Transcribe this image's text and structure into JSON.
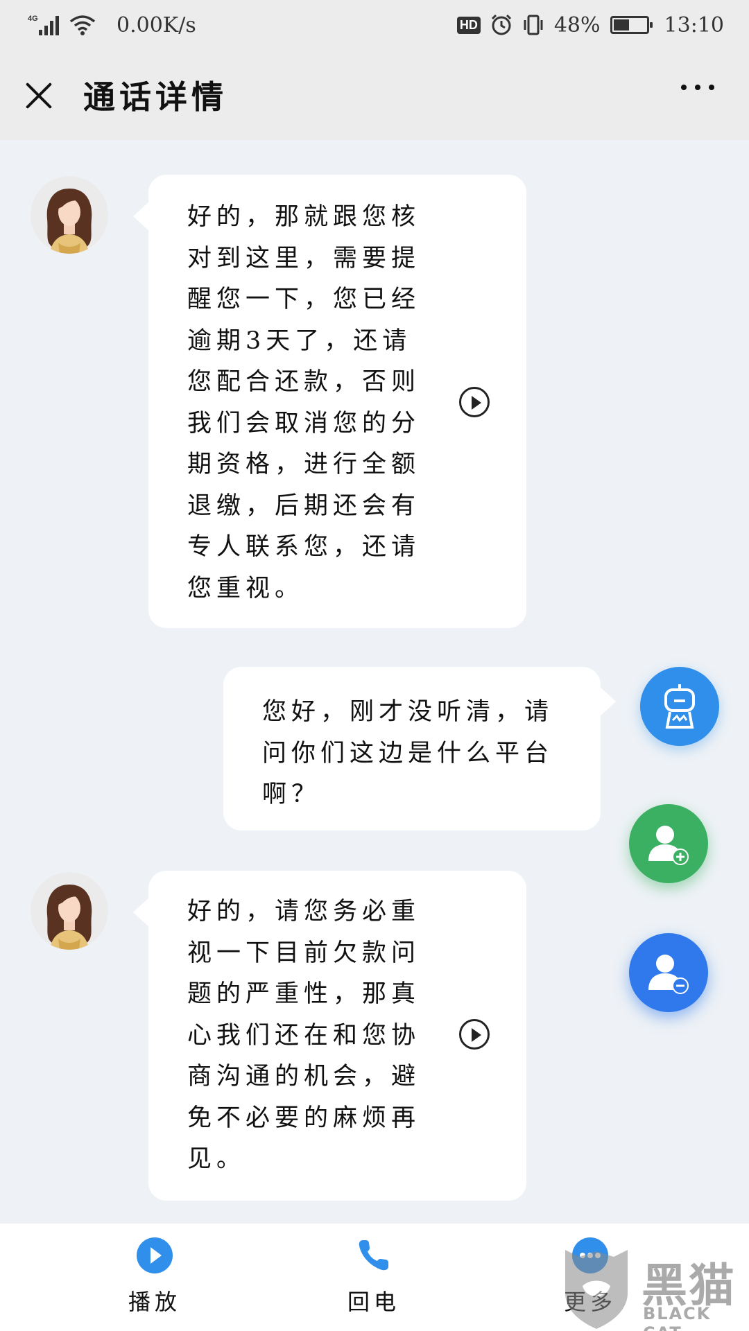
{
  "status_bar": {
    "network": "4G",
    "speed": "0.00K/s",
    "hd": "HD",
    "battery_percent": "48%",
    "battery_level": 0.48,
    "time": "13:10"
  },
  "header": {
    "title": "通话详情"
  },
  "messages": [
    {
      "side": "left",
      "text": "好的，那就跟您核对到这里，需要提醒您一下，您已经逾期3天了，还请您配合还款，否则我们会取消您的分期资格，进行全额退缴，后期还会有专人联系您，还请您重视。"
    },
    {
      "side": "right",
      "text": "您好，刚才没听清，请问你们这边是什么平台啊？"
    },
    {
      "side": "left",
      "text": "好的，请您务必重视一下目前欠款问题的严重性，那真心我们还在和您协商沟通的机会，避免不必要的麻烦再见。"
    }
  ],
  "bottom_tabs": {
    "play": "播放",
    "callback": "回电",
    "more": "更多"
  },
  "watermark": {
    "title": "黑猫",
    "subtitle": "BLACK CAT"
  },
  "colors": {
    "accent_blue": "#2f8fea",
    "green": "#3bb062",
    "background": "#eef2f6"
  }
}
